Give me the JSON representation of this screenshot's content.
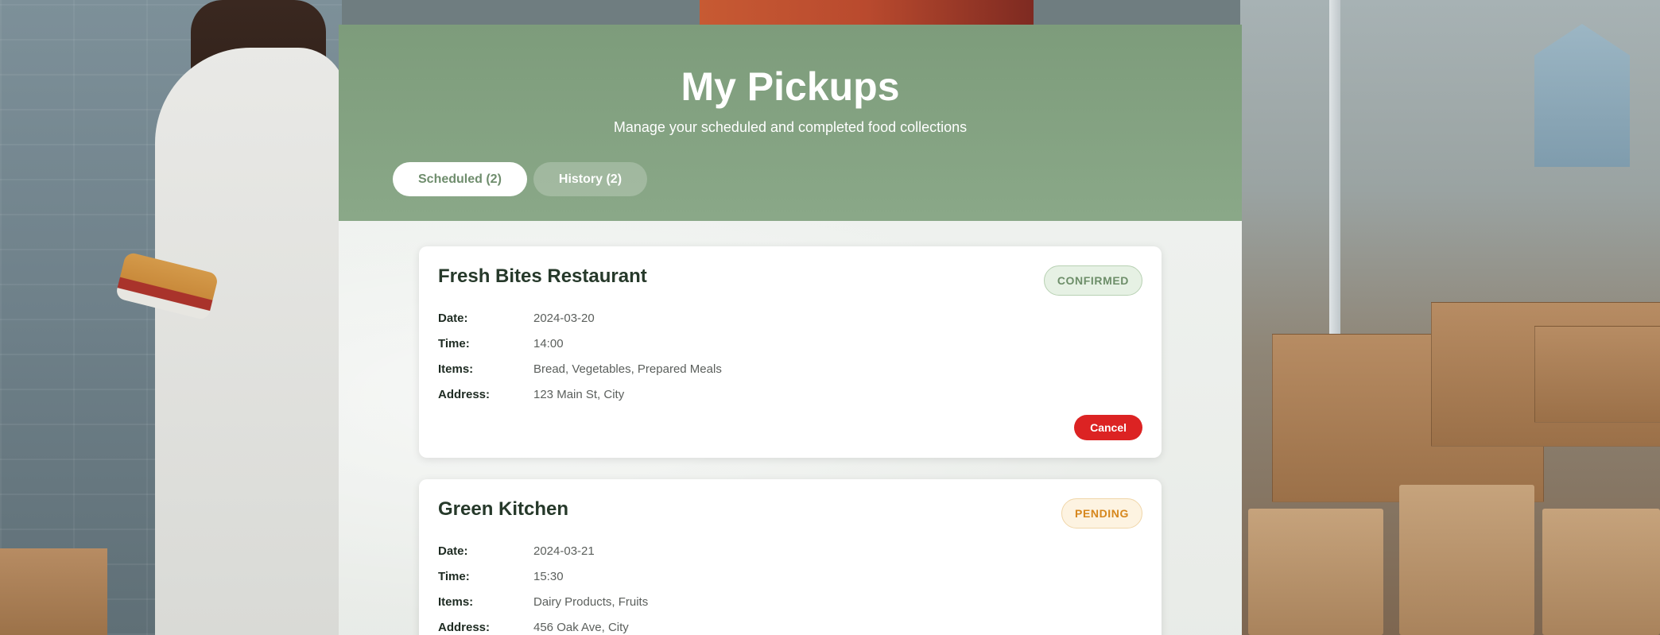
{
  "header": {
    "title": "My Pickups",
    "subtitle": "Manage your scheduled and completed food collections"
  },
  "tabs": [
    {
      "label": "Scheduled (2)",
      "active": true
    },
    {
      "label": "History (2)",
      "active": false
    }
  ],
  "field_labels": {
    "date": "Date:",
    "time": "Time:",
    "items": "Items:",
    "address": "Address:"
  },
  "pickups": [
    {
      "name": "Fresh Bites Restaurant",
      "status": "CONFIRMED",
      "date": "2024-03-20",
      "time": "14:00",
      "items": "Bread, Vegetables, Prepared Meals",
      "address": "123 Main St, City",
      "action_label": "Cancel"
    },
    {
      "name": "Green Kitchen",
      "status": "PENDING",
      "date": "2024-03-21",
      "time": "15:30",
      "items": "Dairy Products, Fruits",
      "address": "456 Oak Ave, City"
    }
  ],
  "colors": {
    "header_green": "#8aa888",
    "confirmed_text": "#6d8e69",
    "pending_text": "#d6871d",
    "cancel_red": "#dc2323"
  }
}
